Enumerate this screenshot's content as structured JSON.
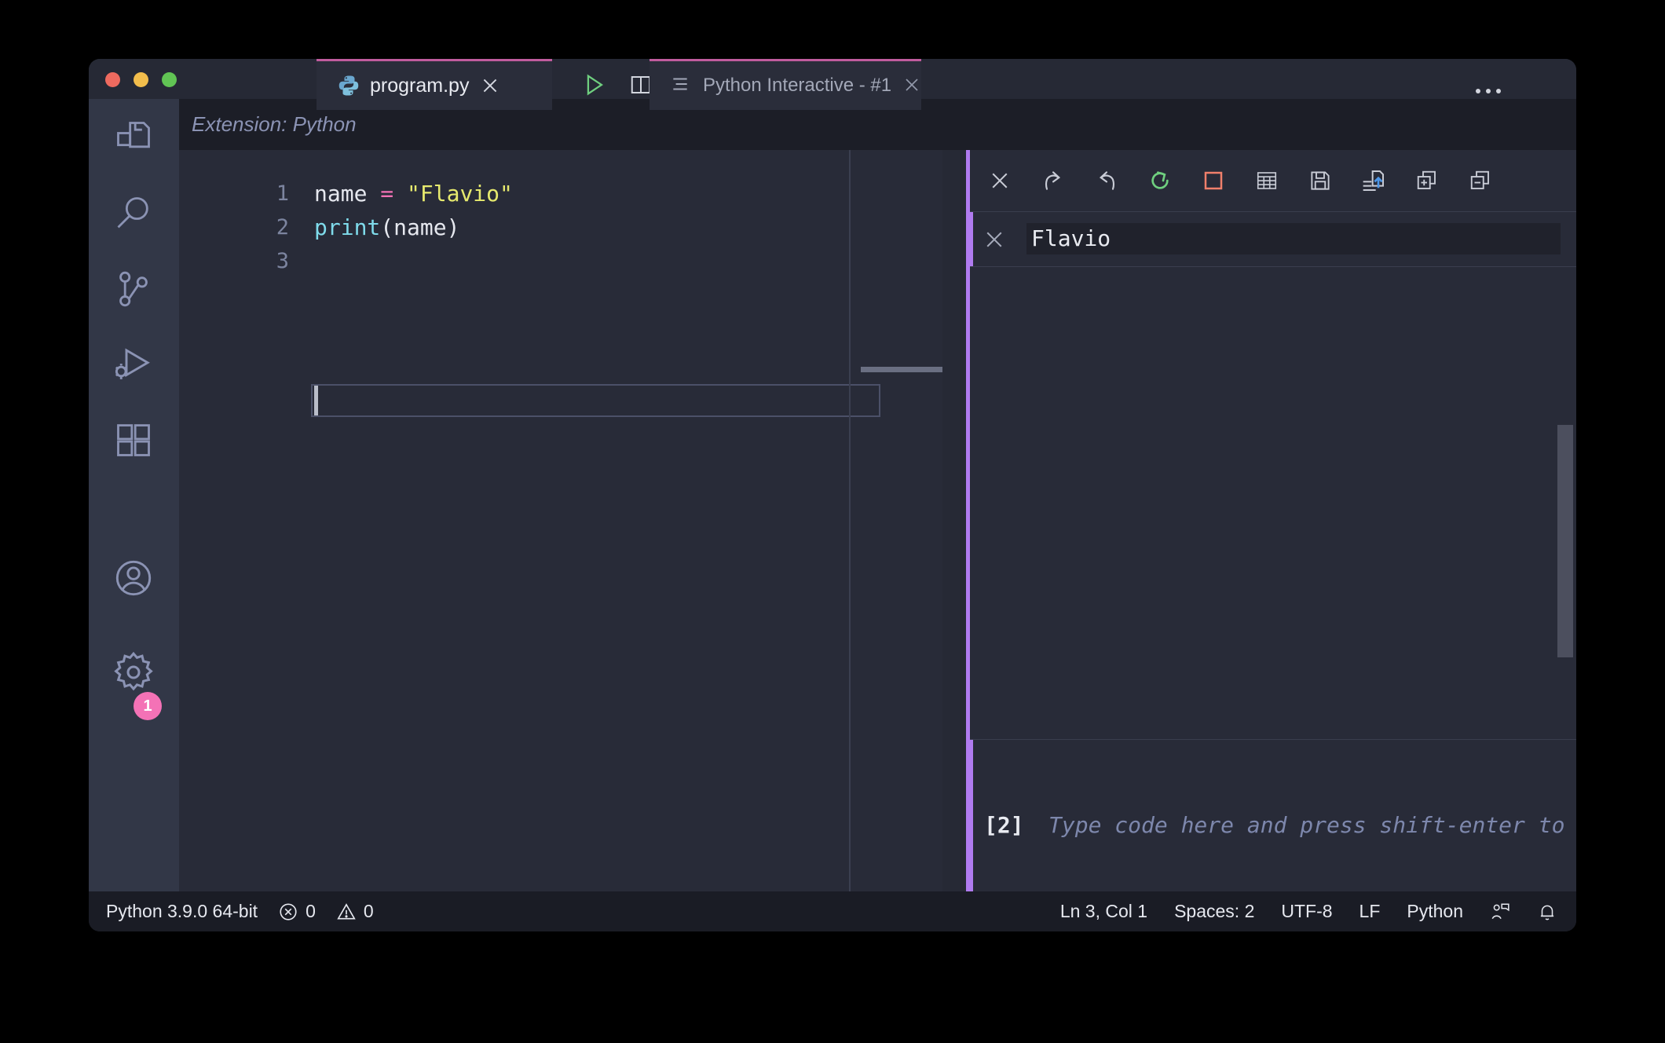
{
  "window": {
    "title": "program.py",
    "traffic_lights": [
      "close",
      "minimize",
      "maximize"
    ]
  },
  "activity_bar": {
    "items": [
      {
        "name": "explorer",
        "icon": "files-icon"
      },
      {
        "name": "search",
        "icon": "search-icon"
      },
      {
        "name": "source-control",
        "icon": "source-control-icon"
      },
      {
        "name": "run-and-debug",
        "icon": "run-debug-icon"
      },
      {
        "name": "extensions",
        "icon": "extensions-icon"
      },
      {
        "name": "accounts",
        "icon": "account-icon"
      },
      {
        "name": "manage",
        "icon": "gear-icon"
      }
    ],
    "badge_count": "1",
    "badge_color": "#f472b6"
  },
  "editor_group": {
    "extension_label": "Extension: Python",
    "tab": {
      "label": "program.py",
      "icon": "python-icon",
      "close_icon": "close-icon",
      "active_border_color": "#c05c9e"
    },
    "actions": [
      {
        "name": "run-python-file",
        "icon": "play-icon",
        "color": "#6fcf7f"
      },
      {
        "name": "split-editor-right",
        "icon": "split-editor-icon"
      },
      {
        "name": "more-actions",
        "icon": "ellipsis-icon"
      }
    ]
  },
  "code": {
    "lines": [
      {
        "number": "1",
        "tokens": [
          {
            "text": "name ",
            "type": "plain"
          },
          {
            "text": "=",
            "type": "operator"
          },
          {
            "text": " ",
            "type": "plain"
          },
          {
            "text": "\"Flavio\"",
            "type": "string"
          }
        ]
      },
      {
        "number": "2",
        "tokens": [
          {
            "text": "print",
            "type": "function"
          },
          {
            "text": "(name)",
            "type": "plain"
          }
        ]
      },
      {
        "number": "3",
        "tokens": []
      }
    ],
    "colors": {
      "plain": "#e6e8ef",
      "operator": "#f472b6",
      "string": "#e6e96e",
      "function": "#7fdbeb",
      "line_number": "#7c849f",
      "background": "#282b38"
    }
  },
  "interactive": {
    "tab": {
      "label": "Python Interactive - #1",
      "icon": "list-icon",
      "close_icon": "close-icon"
    },
    "more_actions_icon": "ellipsis-icon",
    "toolbar": [
      {
        "name": "close-interactive-window",
        "icon": "close-icon",
        "color": "#c9ccd6"
      },
      {
        "name": "redo",
        "icon": "redo-icon",
        "color": "#c9ccd6"
      },
      {
        "name": "undo",
        "icon": "undo-icon",
        "color": "#c9ccd6"
      },
      {
        "name": "restart-kernel",
        "icon": "restart-icon",
        "color": "#6fcf7f"
      },
      {
        "name": "interrupt-kernel",
        "icon": "stop-square-icon",
        "color": "#f07f6b"
      },
      {
        "name": "show-variables",
        "icon": "table-grid-icon",
        "color": "#c9ccd6"
      },
      {
        "name": "save-notebook",
        "icon": "save-floppy-icon",
        "color": "#c9ccd6"
      },
      {
        "name": "export-as-notebook",
        "icon": "export-file-icon",
        "color": "#c9ccd6"
      },
      {
        "name": "expand-all-cells",
        "icon": "expand-plus-icon",
        "color": "#c9ccd6"
      },
      {
        "name": "collapse-all-cells",
        "icon": "collapse-minus-icon",
        "color": "#c9ccd6"
      }
    ],
    "output_cell": {
      "delete_icon": "close-icon",
      "text": "Flavio",
      "marker_color": "#b07bf0"
    },
    "input_cell": {
      "prompt": "[2]",
      "placeholder": "Type code here and press shift-enter to run",
      "marker_color": "#b07bf0"
    }
  },
  "status_bar": {
    "left": [
      {
        "name": "python-interpreter",
        "label": "Python 3.9.0 64-bit",
        "icon": null
      },
      {
        "name": "errors",
        "label": "0",
        "icon": "error-circle-icon"
      },
      {
        "name": "warnings",
        "label": "0",
        "icon": "warning-triangle-icon"
      }
    ],
    "right": [
      {
        "name": "cursor-position",
        "label": "Ln 3, Col 1",
        "icon": null
      },
      {
        "name": "indentation",
        "label": "Spaces: 2",
        "icon": null
      },
      {
        "name": "encoding",
        "label": "UTF-8",
        "icon": null
      },
      {
        "name": "eol",
        "label": "LF",
        "icon": null
      },
      {
        "name": "language-mode",
        "label": "Python",
        "icon": null
      },
      {
        "name": "feedback",
        "label": "",
        "icon": "feedback-person-icon"
      },
      {
        "name": "notifications",
        "label": "",
        "icon": "bell-icon"
      }
    ]
  }
}
